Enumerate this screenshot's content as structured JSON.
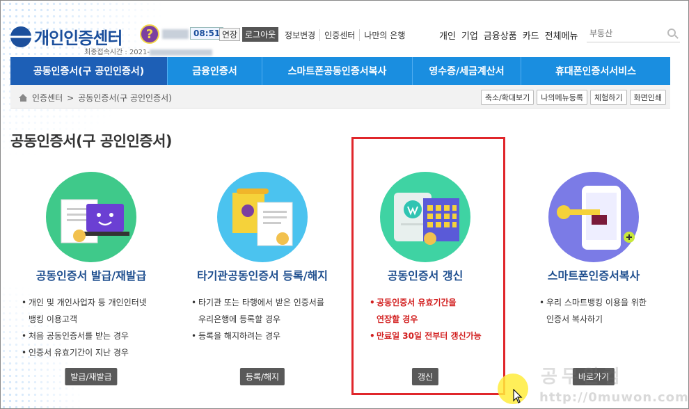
{
  "header": {
    "logo_text": "개인인증센터",
    "timer": "08:51",
    "extend_label": "연장",
    "logout_label": "로그아웃",
    "util_links": [
      "정보변경",
      "인증센터",
      "나만의 은행"
    ],
    "last_login_label": "최종접속시간 :",
    "last_login_value": "2021-",
    "gnb": [
      "개인",
      "기업",
      "금융상품",
      "카드",
      "전체메뉴"
    ],
    "search_placeholder": "부동산"
  },
  "main_nav": [
    {
      "label": "공동인증서(구 공인인증서)",
      "active": true
    },
    {
      "label": "금융인증서",
      "active": false
    },
    {
      "label": "스마트폰공동인증서복사",
      "active": false
    },
    {
      "label": "영수증/세금계산서",
      "active": false
    },
    {
      "label": "휴대폰인증서서비스",
      "active": false
    }
  ],
  "breadcrumb": {
    "home": "인증센터",
    "separator": ">",
    "current": "공동인증서(구 공인인증서)"
  },
  "tools": [
    "축소/확대보기",
    "나의메뉴등록",
    "체험하기",
    "화면인쇄"
  ],
  "page_title": "공동인증서(구 공인인증서)",
  "cards": [
    {
      "title": "공동인증서 발급/재발급",
      "items": [
        "개인 및 개인사업자 등 개인인터넷",
        "뱅킹 이용고객",
        "처음 공동인증서를 받는 경우",
        "인증서 유효기간이 지난 경우"
      ],
      "bullets": [
        true,
        false,
        true,
        true
      ],
      "button": "발급/재발급",
      "circle_color": "#3fc98a"
    },
    {
      "title": "타기관공동인증서 등록/해지",
      "items": [
        "타기관 또는 타행에서 받은 인증서를",
        "우리은행에 등록할 경우",
        "등록을 해지하려는 경우"
      ],
      "bullets": [
        true,
        false,
        true
      ],
      "button": "등록/해지",
      "circle_color": "#4bc3ef"
    },
    {
      "title": "공동인증서 갱신",
      "items": [
        "공동인증서 유효기간을",
        "연장할 경우",
        "만료일 30일 전부터 갱신가능"
      ],
      "bullets": [
        true,
        false,
        true
      ],
      "button": "갱신",
      "circle_color": "#3fd3a3"
    },
    {
      "title": "스마트폰인증서복사",
      "items": [
        "우리 스마트뱅킹 이용을 위한",
        "인증서 복사하기"
      ],
      "bullets": [
        true,
        false
      ],
      "button": "바로가기",
      "circle_color": "#7b7be6"
    }
  ],
  "watermark": {
    "line1": "공무원컴",
    "line2": "http://0muwon.com"
  },
  "colors": {
    "nav_blue": "#1a8ee0",
    "nav_active": "#1d5fb6",
    "highlight_red": "#e0262b",
    "title_blue": "#1f4f8f"
  }
}
